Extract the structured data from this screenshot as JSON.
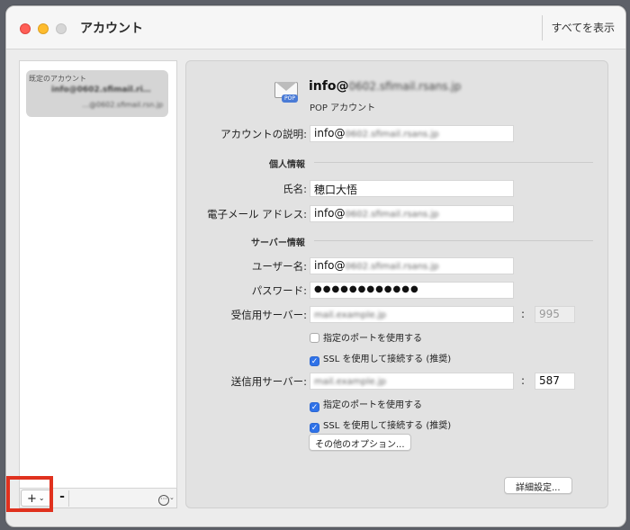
{
  "window": {
    "title": "アカウント",
    "show_all_label": "すべてを表示"
  },
  "sidebar": {
    "section_header": "既定のアカウント",
    "account_line1": "info@0602.sfimail.ri…",
    "account_line2": "…@0602.sfimail.rsn.jp"
  },
  "sidebar_toolbar": {
    "add_label": "+",
    "remove_label": "-"
  },
  "account": {
    "email_prefix": "info@",
    "email_domain": "0602.sfimail.rsans.jp",
    "type": "POP アカウント"
  },
  "form": {
    "description_label": "アカウントの説明:",
    "description_prefix": "info@",
    "description_domain": "0602.sfimail.rsans.jp",
    "personal_section": "個人情報",
    "name_label": "氏名:",
    "name_value": "穂口大悟",
    "email_label": "電子メール アドレス:",
    "email_prefix": "info@",
    "email_domain": "0602.sfimail.rsans.jp",
    "server_section": "サーバー情報",
    "username_label": "ユーザー名:",
    "username_prefix": "info@",
    "username_domain": "0602.sfimail.rsans.jp",
    "password_label": "パスワード:",
    "password_value": "●●●●●●●●●●●●",
    "incoming_label": "受信用サーバー:",
    "incoming_value": "mail.example.jp",
    "incoming_port": "995",
    "use_port_label": "指定のポートを使用する",
    "ssl_label": "SSL を使用して接続する (推奨)",
    "outgoing_label": "送信用サーバー:",
    "outgoing_value": "mail.example.jp",
    "outgoing_port": "587",
    "use_port_label_2": "指定のポートを使用する",
    "ssl_label_2": "SSL を使用して接続する (推奨)",
    "other_options_label": "その他のオプション...",
    "advanced_label": "詳細設定..."
  },
  "checkboxes": {
    "incoming_use_port": false,
    "incoming_ssl": true,
    "outgoing_use_port": true,
    "outgoing_ssl": true
  },
  "colors": {
    "accent": "#2f72e8",
    "highlight": "#e0311e"
  }
}
